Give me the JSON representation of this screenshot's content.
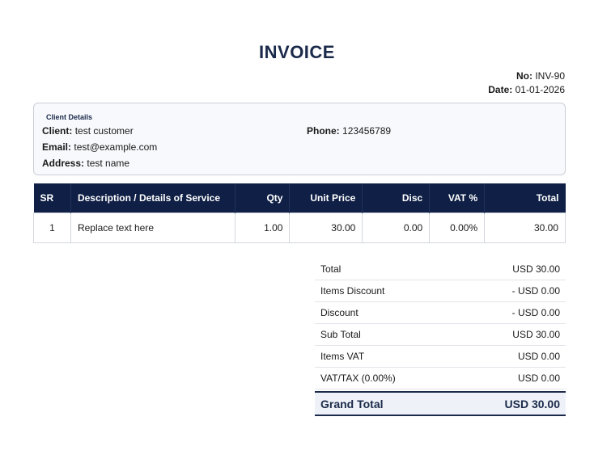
{
  "header": {
    "title": "INVOICE"
  },
  "meta": {
    "no_label": "No:",
    "no_value": "INV-90",
    "date_label": "Date:",
    "date_value": "01-01-2026"
  },
  "client": {
    "heading": "Client Details",
    "client_label": "Client:",
    "client_value": "test customer",
    "phone_label": "Phone:",
    "phone_value": "123456789",
    "email_label": "Email:",
    "email_value": "test@example.com",
    "address_label": "Address:",
    "address_value": "test name"
  },
  "table": {
    "headers": [
      "SR",
      "Description / Details of Service",
      "Qty",
      "Unit Price",
      "Disc",
      "VAT %",
      "Total"
    ],
    "rows": [
      [
        "1",
        "Replace text here",
        "1.00",
        "30.00",
        "0.00",
        "0.00%",
        "30.00"
      ]
    ]
  },
  "summary": {
    "rows": [
      {
        "label": "Total",
        "value": "USD 30.00"
      },
      {
        "label": "Items Discount",
        "value": "- USD 0.00"
      },
      {
        "label": "Discount",
        "value": "- USD 0.00"
      },
      {
        "label": "Sub Total",
        "value": "USD 30.00"
      },
      {
        "label": "Items VAT",
        "value": "USD 0.00"
      },
      {
        "label": "VAT/TAX (0.00%)",
        "value": "USD 0.00"
      }
    ],
    "grand_label": "Grand Total",
    "grand_value": "USD 30.00"
  },
  "colors": {
    "header_bg": "#0f1f45",
    "title": "#1b2a4a"
  }
}
